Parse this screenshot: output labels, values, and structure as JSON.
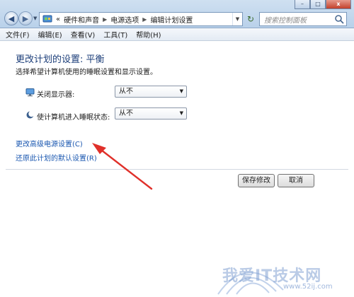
{
  "address_bar": {
    "prefix": "«",
    "crumbs": [
      "硬件和声音",
      "电源选项",
      "编辑计划设置"
    ]
  },
  "search": {
    "placeholder": "搜索控制面板"
  },
  "window_controls": {
    "minimize": "–",
    "maximize": "□",
    "close": "x"
  },
  "menubar": {
    "items": [
      "文件(F)",
      "编辑(E)",
      "查看(V)",
      "工具(T)",
      "帮助(H)"
    ]
  },
  "content": {
    "title": "更改计划的设置: 平衡",
    "subtitle": "选择希望计算机使用的睡眠设置和显示设置。",
    "settings": [
      {
        "label": "关闭显示器:",
        "value": "从不",
        "icon": "monitor-icon"
      },
      {
        "label": "使计算机进入睡眠状态:",
        "value": "从不",
        "icon": "moon-icon"
      }
    ],
    "links": {
      "advanced": "更改高级电源设置(C)",
      "restore": "还原此计划的默认设置(R)"
    },
    "buttons": {
      "save": "保存修改",
      "cancel": "取消"
    }
  },
  "watermark": {
    "text": "我爱IT技术网",
    "url": "www.52ij.com"
  },
  "colors": {
    "title_blue": "#1d3f7a",
    "link_blue": "#1a57b0",
    "arrow_red": "#e0302a"
  }
}
